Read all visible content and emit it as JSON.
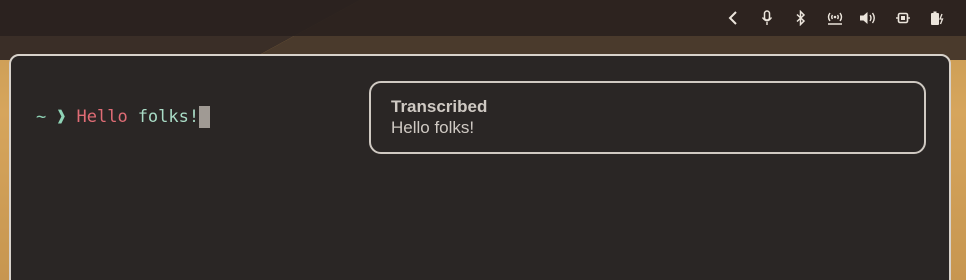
{
  "topbar": {
    "tray_icons": [
      "chevron-left-icon",
      "microphone-icon",
      "bluetooth-icon",
      "wifi-hotspot-icon",
      "volume-icon",
      "cpu-icon",
      "battery-charging-icon"
    ]
  },
  "terminal": {
    "prompt_symbol": "~",
    "prompt_arrow": "❱",
    "command": "Hello",
    "argument": "folks",
    "trailing": "!"
  },
  "notification": {
    "title": "Transcribed",
    "body": "Hello folks!"
  },
  "colors": {
    "terminal_bg": "#2a2625",
    "prompt": "#8fd3b6",
    "command": "#e06c75",
    "argument": "#a9dcc6",
    "wallpaper": "#d6a55c"
  }
}
